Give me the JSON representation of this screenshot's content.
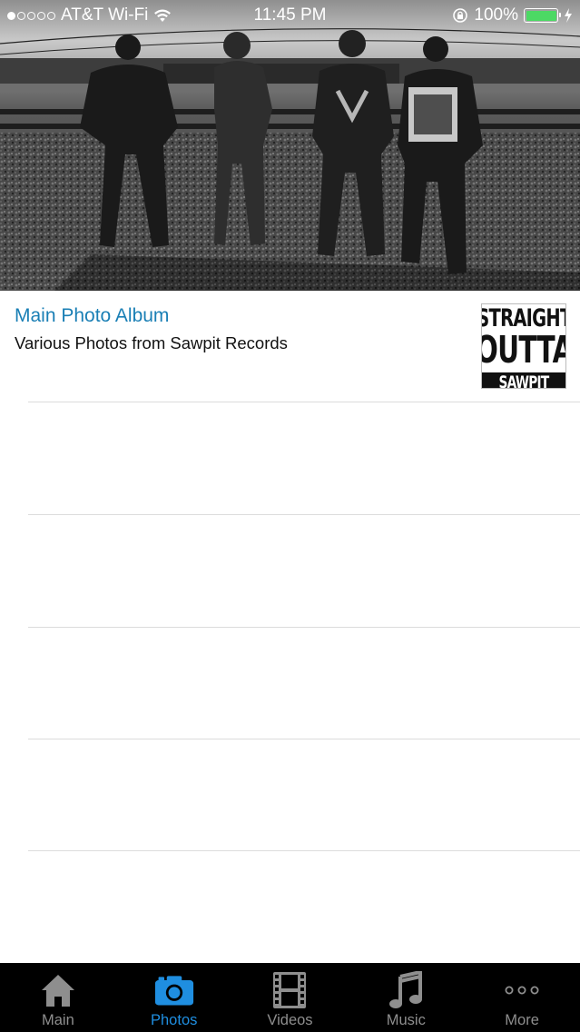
{
  "status_bar": {
    "carrier": "AT&T Wi-Fi",
    "time": "11:45 PM",
    "battery_percent": "100%",
    "signal_bars_filled": 1,
    "signal_bars_total": 5
  },
  "album": {
    "title": "Main Photo Album",
    "subtitle": "Various Photos from Sawpit Records",
    "thumbnail_text": [
      "STRAIGHT",
      "OUTTA",
      "SAWPIT"
    ]
  },
  "tab_bar": {
    "active_tab": "Photos",
    "accent_color": "#1f8ee0",
    "tabs": [
      {
        "label": "Main",
        "icon": "home-icon"
      },
      {
        "label": "Photos",
        "icon": "camera-icon"
      },
      {
        "label": "Videos",
        "icon": "film-icon"
      },
      {
        "label": "Music",
        "icon": "music-note-icon"
      },
      {
        "label": "More",
        "icon": "more-dots-icon"
      }
    ]
  }
}
